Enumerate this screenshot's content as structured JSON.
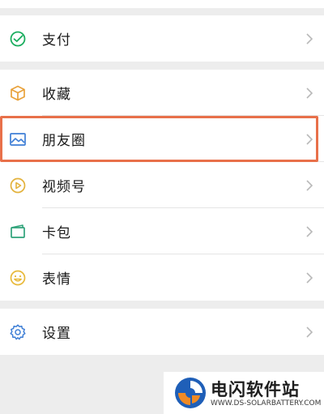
{
  "menu": {
    "pay": {
      "label": "支付",
      "icon": "wechat-pay-icon"
    },
    "favorites": {
      "label": "收藏",
      "icon": "cube-icon"
    },
    "moments": {
      "label": "朋友圈",
      "icon": "image-icon"
    },
    "channels": {
      "label": "视频号",
      "icon": "play-icon"
    },
    "cards": {
      "label": "卡包",
      "icon": "card-icon"
    },
    "stickers": {
      "label": "表情",
      "icon": "smile-icon"
    },
    "settings": {
      "label": "设置",
      "icon": "gear-icon"
    }
  },
  "highlight_color": "#e8704a",
  "watermark": {
    "title": "电闪软件站",
    "subtitle": "WWW.DS-SOLARBATTERY.COM"
  }
}
